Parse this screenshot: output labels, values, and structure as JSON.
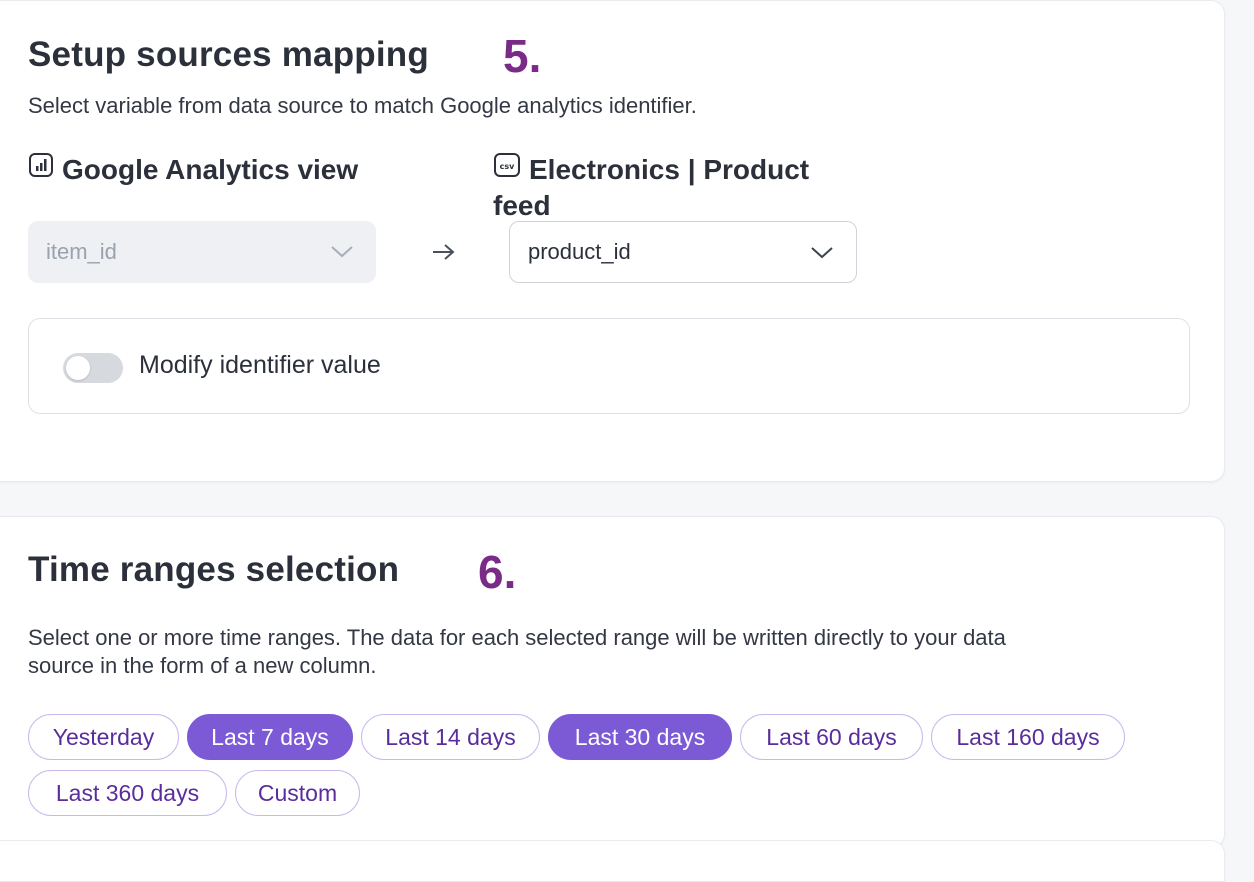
{
  "mapping": {
    "title": "Setup sources mapping",
    "step": "5.",
    "description": "Select variable from data source to match Google analytics identifier.",
    "left": {
      "icon": "analytics-chart-icon",
      "label": "Google Analytics view",
      "select_value": "item_id"
    },
    "arrow_icon": "arrow-right-icon",
    "right": {
      "icon": "csv-file-icon",
      "label_line1": "Electronics | Product",
      "label_line2": "feed",
      "select_value": "product_id"
    },
    "toggle": {
      "label": "Modify identifier value",
      "on": false
    }
  },
  "time_ranges": {
    "title": "Time ranges selection",
    "step": "6.",
    "description_line1": "Select one or more time ranges. The data for each selected range will be written directly to your data",
    "description_line2": "source in the form of a new column.",
    "chips": [
      {
        "label": "Yesterday",
        "selected": false
      },
      {
        "label": "Last 7 days",
        "selected": true
      },
      {
        "label": "Last 14 days",
        "selected": false
      },
      {
        "label": "Last 30 days",
        "selected": true
      },
      {
        "label": "Last 60 days",
        "selected": false
      },
      {
        "label": "Last 160 days",
        "selected": false
      },
      {
        "label": "Last 360 days",
        "selected": false
      },
      {
        "label": "Custom",
        "selected": false
      }
    ]
  },
  "colors": {
    "accent": "#7c5ad6",
    "step_number": "#7a2a87",
    "chip_text": "#5a2d9c",
    "chip_border": "#c9b8ee"
  }
}
